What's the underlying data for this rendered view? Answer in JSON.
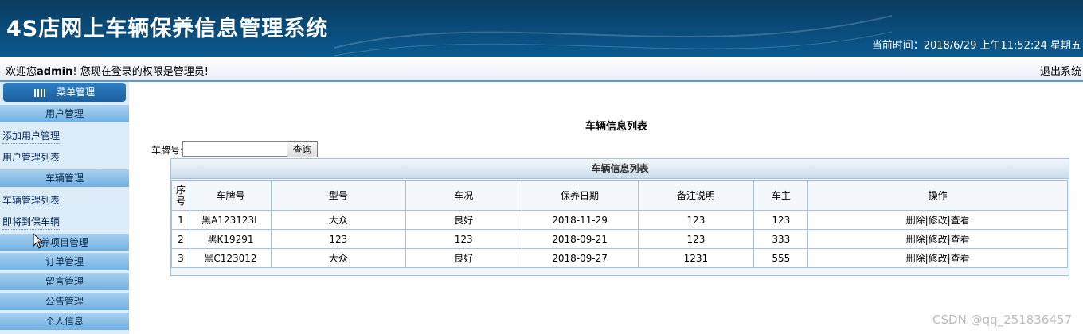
{
  "header": {
    "title": "4S店网上车辆保养信息管理系统",
    "time": "当前时间：2018/6/29 上午11:52:24 星期五"
  },
  "welcome": {
    "prefix": "欢迎您",
    "user": "admin",
    "suffix": "! 您现在登录的权限是管理员!",
    "logout": "退出系统"
  },
  "sidebar": {
    "menu_title": "菜单管理",
    "sections": {
      "user": "用户管理",
      "vehicle": "车辆管理",
      "maintenance": "养项目管理",
      "order": "订单管理",
      "message": "留言管理",
      "notice": "公告管理",
      "personal": "个人信息"
    },
    "links": {
      "add_user": "添加用户管理",
      "user_list": "用户管理列表",
      "vehicle_list": "车辆管理列表",
      "due_vehicles": "即将到保车辆"
    }
  },
  "main": {
    "page_title": "车辆信息列表",
    "search_label": "车牌号:",
    "search_value": "",
    "search_button": "查询",
    "list_caption": "车辆信息列表",
    "columns": [
      "序号",
      "车牌号",
      "型号",
      "车况",
      "保养日期",
      "备注说明",
      "车主",
      "操作"
    ],
    "rows": [
      {
        "no": "1",
        "plate": "黑A123123L",
        "model": "大众",
        "condition": "良好",
        "date": "2018-11-29",
        "note": "123",
        "owner": "123",
        "actions": [
          "删除",
          "修改",
          "查看"
        ]
      },
      {
        "no": "2",
        "plate": "黑K19291",
        "model": "123",
        "condition": "123",
        "date": "2018-09-21",
        "note": "123",
        "owner": "333",
        "actions": [
          "删除",
          "修改",
          "查看"
        ]
      },
      {
        "no": "3",
        "plate": "黑C123012",
        "model": "大众",
        "condition": "良好",
        "date": "2018-09-27",
        "note": "1231",
        "owner": "555",
        "actions": [
          "删除",
          "修改",
          "查看"
        ]
      }
    ]
  },
  "watermark": "CSDN @qq_251836457",
  "colors": {
    "header_bg": "#0a4a78",
    "sidebar_bg": "#dcecf8",
    "section_bg": "#6fb0e3",
    "border": "#a9c1d8"
  }
}
